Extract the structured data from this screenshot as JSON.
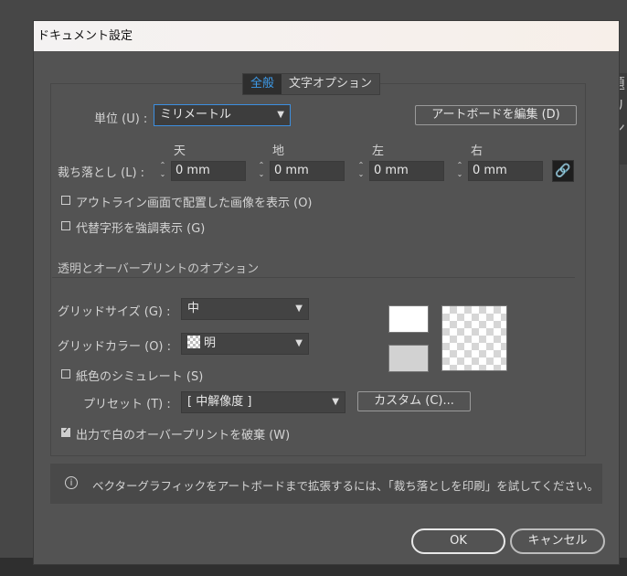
{
  "window": {
    "title": "ドキュメント設定"
  },
  "tabs": [
    {
      "label": "全般"
    },
    {
      "label": "文字オプション"
    }
  ],
  "units": {
    "label": "単位 (U) :",
    "value": "ミリメートル"
  },
  "edit_artboard_button": "アートボードを編集 (D)",
  "bleed": {
    "label": "裁ち落とし (L) :",
    "top_label": "天",
    "top_value": "0 mm",
    "bottom_label": "地",
    "bottom_value": "0 mm",
    "left_label": "左",
    "left_value": "0 mm",
    "right_label": "右",
    "right_value": "0 mm"
  },
  "checkboxes": {
    "outline_images": {
      "label": "アウトライン画面で配置した画像を表示 (O)",
      "checked": false
    },
    "highlight_substituted": {
      "label": "代替字形を強調表示 (G)",
      "checked": false
    },
    "simulate_paper": {
      "label": "紙色のシミュレート (S)",
      "checked": false
    },
    "discard_white_overprint": {
      "label": "出力で白のオーバープリントを破棄 (W)",
      "checked": true
    }
  },
  "transparency": {
    "section_title": "透明とオーバープリントのオプション",
    "grid_size_label": "グリッドサイズ (G) :",
    "grid_size_value": "中",
    "grid_color_label": "グリッドカラー (O) :",
    "grid_color_value": "明",
    "preset_label": "プリセット (T) :",
    "preset_value": "[ 中解像度 ]",
    "custom_button": "カスタム (C)..."
  },
  "info_text": "ベクターグラフィックをアートボードまで拡張するには、「裁ち落としを印刷」を試してください。",
  "buttons": {
    "ok": "OK",
    "cancel": "キャンセル"
  },
  "background": {
    "right_edge_text": "題\nリ\nン"
  },
  "colors": {
    "accent": "#3d9be9",
    "dialog_bg": "#535353",
    "title_bg": "#f4f2f2"
  }
}
